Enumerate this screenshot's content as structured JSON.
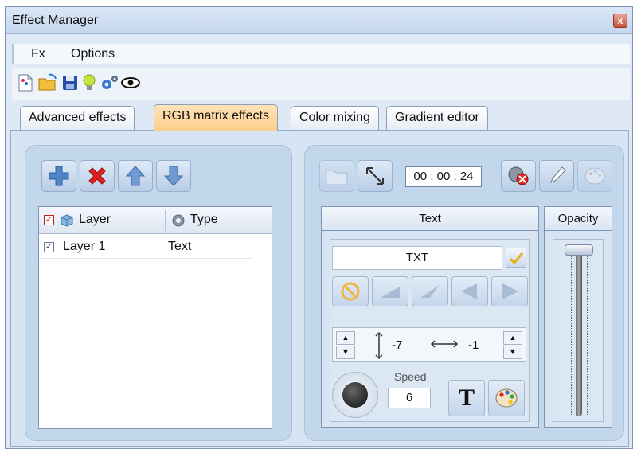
{
  "window": {
    "title": "Effect Manager",
    "close_label": "x"
  },
  "menu": {
    "items": [
      "Fx",
      "Options"
    ]
  },
  "tabs": [
    "Advanced effects",
    "RGB matrix effects",
    "Color mixing",
    "Gradient editor"
  ],
  "active_tab": "RGB matrix effects",
  "layers": {
    "columns": [
      "Layer",
      "Type"
    ],
    "rows": [
      {
        "name": "Layer 1",
        "type": "Text",
        "checked": true
      }
    ]
  },
  "timer": "00 : 00 : 24",
  "panels": {
    "text_header": "Text",
    "opacity_header": "Opacity",
    "text_value": "TXT",
    "offset_y": "-7",
    "offset_x": "-1",
    "speed_label": "Speed",
    "speed_value": "6"
  },
  "colors": {
    "active_tab": "#fbcf8c",
    "background": "#d6e4f3",
    "accent": "#e02020"
  }
}
